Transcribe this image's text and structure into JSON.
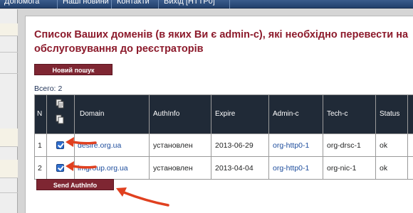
{
  "nav": {
    "items": [
      "Допомога",
      "Наші новини",
      "Контакти",
      "Вихід [HTTP0]"
    ]
  },
  "page": {
    "title": "Список Ваших доменів (в яких Ви є admin-c), які необхідно перевести на обслуговування до реєстраторів",
    "new_search_label": "Новий пошук",
    "total_label": "Всего:",
    "total_value": "2",
    "send_authinfo_label": "Send AuthInfo"
  },
  "table": {
    "columns": [
      "N",
      "",
      "Domain",
      "AuthInfo",
      "Expire",
      "Admin-c",
      "Tech-c",
      "Status"
    ],
    "rows": [
      {
        "n": "1",
        "checked": true,
        "domain": "desire.org.ua",
        "authinfo": "установлен",
        "expire": "2013-06-29",
        "admin_c": "org-http0-1",
        "tech_c": "org-drsc-1",
        "status": "ok"
      },
      {
        "n": "2",
        "checked": true,
        "domain": "imgroup.org.ua",
        "authinfo": "установлен",
        "expire": "2013-04-04",
        "admin_c": "org-http0-1",
        "tech_c": "org-nic-1",
        "status": "ok"
      }
    ]
  },
  "colors": {
    "title": "#8c1a2b",
    "button": "#7e2632",
    "header_bg": "#202a37",
    "link": "#1c4c9c",
    "annotation_arrow": "#e0401f"
  },
  "icons": [
    "copy-icon",
    "checkbox-checked-icon",
    "arrow-annotation"
  ]
}
